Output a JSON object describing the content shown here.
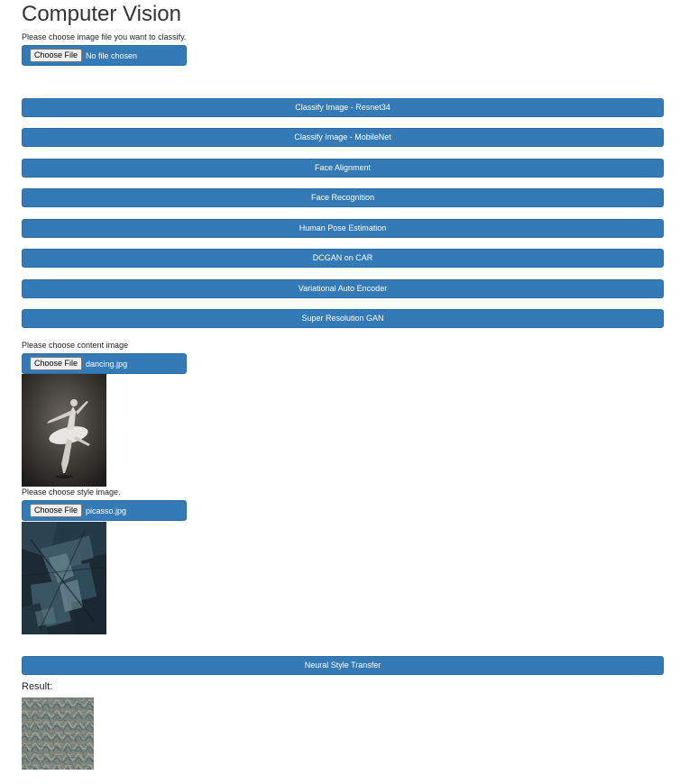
{
  "header": {
    "title": "Computer Vision"
  },
  "classify_upload": {
    "label": "Please choose image file you want to classify.",
    "choose_label": "Choose File",
    "file_name": "No file chosen"
  },
  "actions": [
    "Classify Image - Resnet34",
    "Classify Image - MobileNet",
    "Face Alignment",
    "Face Recognition",
    "Human Pose Estimation",
    "DCGAN on CAR",
    "Variational Auto Encoder",
    "Super Resolution GAN"
  ],
  "content_upload": {
    "label": "Please choose content image",
    "choose_label": "Choose File",
    "file_name": "dancing.jpg"
  },
  "style_upload": {
    "label": "Please choose style image.",
    "choose_label": "Choose File",
    "file_name": "picasso.jpg"
  },
  "style_transfer": {
    "button_label": "Neural Style Transfer"
  },
  "result": {
    "label": "Result:"
  },
  "colors": {
    "primary": "#337ab7",
    "primary_border": "#2e6da4"
  }
}
